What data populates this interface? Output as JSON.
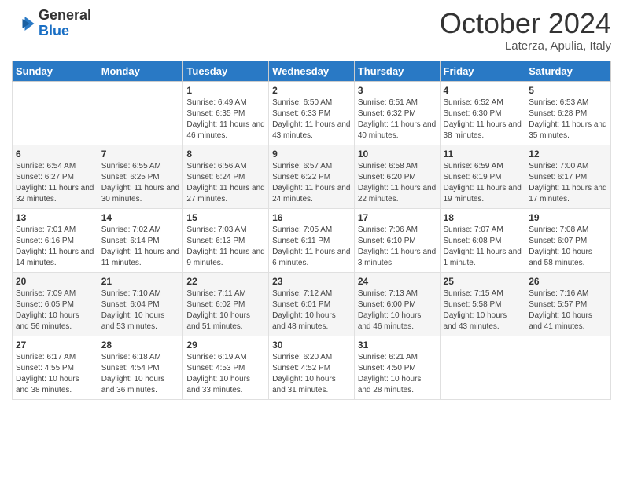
{
  "header": {
    "logo_general": "General",
    "logo_blue": "Blue",
    "month_title": "October 2024",
    "location": "Laterza, Apulia, Italy"
  },
  "days_of_week": [
    "Sunday",
    "Monday",
    "Tuesday",
    "Wednesday",
    "Thursday",
    "Friday",
    "Saturday"
  ],
  "weeks": [
    [
      {
        "day": "",
        "sunrise": "",
        "sunset": "",
        "daylight": ""
      },
      {
        "day": "",
        "sunrise": "",
        "sunset": "",
        "daylight": ""
      },
      {
        "day": "1",
        "sunrise": "Sunrise: 6:49 AM",
        "sunset": "Sunset: 6:35 PM",
        "daylight": "Daylight: 11 hours and 46 minutes."
      },
      {
        "day": "2",
        "sunrise": "Sunrise: 6:50 AM",
        "sunset": "Sunset: 6:33 PM",
        "daylight": "Daylight: 11 hours and 43 minutes."
      },
      {
        "day": "3",
        "sunrise": "Sunrise: 6:51 AM",
        "sunset": "Sunset: 6:32 PM",
        "daylight": "Daylight: 11 hours and 40 minutes."
      },
      {
        "day": "4",
        "sunrise": "Sunrise: 6:52 AM",
        "sunset": "Sunset: 6:30 PM",
        "daylight": "Daylight: 11 hours and 38 minutes."
      },
      {
        "day": "5",
        "sunrise": "Sunrise: 6:53 AM",
        "sunset": "Sunset: 6:28 PM",
        "daylight": "Daylight: 11 hours and 35 minutes."
      }
    ],
    [
      {
        "day": "6",
        "sunrise": "Sunrise: 6:54 AM",
        "sunset": "Sunset: 6:27 PM",
        "daylight": "Daylight: 11 hours and 32 minutes."
      },
      {
        "day": "7",
        "sunrise": "Sunrise: 6:55 AM",
        "sunset": "Sunset: 6:25 PM",
        "daylight": "Daylight: 11 hours and 30 minutes."
      },
      {
        "day": "8",
        "sunrise": "Sunrise: 6:56 AM",
        "sunset": "Sunset: 6:24 PM",
        "daylight": "Daylight: 11 hours and 27 minutes."
      },
      {
        "day": "9",
        "sunrise": "Sunrise: 6:57 AM",
        "sunset": "Sunset: 6:22 PM",
        "daylight": "Daylight: 11 hours and 24 minutes."
      },
      {
        "day": "10",
        "sunrise": "Sunrise: 6:58 AM",
        "sunset": "Sunset: 6:20 PM",
        "daylight": "Daylight: 11 hours and 22 minutes."
      },
      {
        "day": "11",
        "sunrise": "Sunrise: 6:59 AM",
        "sunset": "Sunset: 6:19 PM",
        "daylight": "Daylight: 11 hours and 19 minutes."
      },
      {
        "day": "12",
        "sunrise": "Sunrise: 7:00 AM",
        "sunset": "Sunset: 6:17 PM",
        "daylight": "Daylight: 11 hours and 17 minutes."
      }
    ],
    [
      {
        "day": "13",
        "sunrise": "Sunrise: 7:01 AM",
        "sunset": "Sunset: 6:16 PM",
        "daylight": "Daylight: 11 hours and 14 minutes."
      },
      {
        "day": "14",
        "sunrise": "Sunrise: 7:02 AM",
        "sunset": "Sunset: 6:14 PM",
        "daylight": "Daylight: 11 hours and 11 minutes."
      },
      {
        "day": "15",
        "sunrise": "Sunrise: 7:03 AM",
        "sunset": "Sunset: 6:13 PM",
        "daylight": "Daylight: 11 hours and 9 minutes."
      },
      {
        "day": "16",
        "sunrise": "Sunrise: 7:05 AM",
        "sunset": "Sunset: 6:11 PM",
        "daylight": "Daylight: 11 hours and 6 minutes."
      },
      {
        "day": "17",
        "sunrise": "Sunrise: 7:06 AM",
        "sunset": "Sunset: 6:10 PM",
        "daylight": "Daylight: 11 hours and 3 minutes."
      },
      {
        "day": "18",
        "sunrise": "Sunrise: 7:07 AM",
        "sunset": "Sunset: 6:08 PM",
        "daylight": "Daylight: 11 hours and 1 minute."
      },
      {
        "day": "19",
        "sunrise": "Sunrise: 7:08 AM",
        "sunset": "Sunset: 6:07 PM",
        "daylight": "Daylight: 10 hours and 58 minutes."
      }
    ],
    [
      {
        "day": "20",
        "sunrise": "Sunrise: 7:09 AM",
        "sunset": "Sunset: 6:05 PM",
        "daylight": "Daylight: 10 hours and 56 minutes."
      },
      {
        "day": "21",
        "sunrise": "Sunrise: 7:10 AM",
        "sunset": "Sunset: 6:04 PM",
        "daylight": "Daylight: 10 hours and 53 minutes."
      },
      {
        "day": "22",
        "sunrise": "Sunrise: 7:11 AM",
        "sunset": "Sunset: 6:02 PM",
        "daylight": "Daylight: 10 hours and 51 minutes."
      },
      {
        "day": "23",
        "sunrise": "Sunrise: 7:12 AM",
        "sunset": "Sunset: 6:01 PM",
        "daylight": "Daylight: 10 hours and 48 minutes."
      },
      {
        "day": "24",
        "sunrise": "Sunrise: 7:13 AM",
        "sunset": "Sunset: 6:00 PM",
        "daylight": "Daylight: 10 hours and 46 minutes."
      },
      {
        "day": "25",
        "sunrise": "Sunrise: 7:15 AM",
        "sunset": "Sunset: 5:58 PM",
        "daylight": "Daylight: 10 hours and 43 minutes."
      },
      {
        "day": "26",
        "sunrise": "Sunrise: 7:16 AM",
        "sunset": "Sunset: 5:57 PM",
        "daylight": "Daylight: 10 hours and 41 minutes."
      }
    ],
    [
      {
        "day": "27",
        "sunrise": "Sunrise: 6:17 AM",
        "sunset": "Sunset: 4:55 PM",
        "daylight": "Daylight: 10 hours and 38 minutes."
      },
      {
        "day": "28",
        "sunrise": "Sunrise: 6:18 AM",
        "sunset": "Sunset: 4:54 PM",
        "daylight": "Daylight: 10 hours and 36 minutes."
      },
      {
        "day": "29",
        "sunrise": "Sunrise: 6:19 AM",
        "sunset": "Sunset: 4:53 PM",
        "daylight": "Daylight: 10 hours and 33 minutes."
      },
      {
        "day": "30",
        "sunrise": "Sunrise: 6:20 AM",
        "sunset": "Sunset: 4:52 PM",
        "daylight": "Daylight: 10 hours and 31 minutes."
      },
      {
        "day": "31",
        "sunrise": "Sunrise: 6:21 AM",
        "sunset": "Sunset: 4:50 PM",
        "daylight": "Daylight: 10 hours and 28 minutes."
      },
      {
        "day": "",
        "sunrise": "",
        "sunset": "",
        "daylight": ""
      },
      {
        "day": "",
        "sunrise": "",
        "sunset": "",
        "daylight": ""
      }
    ]
  ]
}
